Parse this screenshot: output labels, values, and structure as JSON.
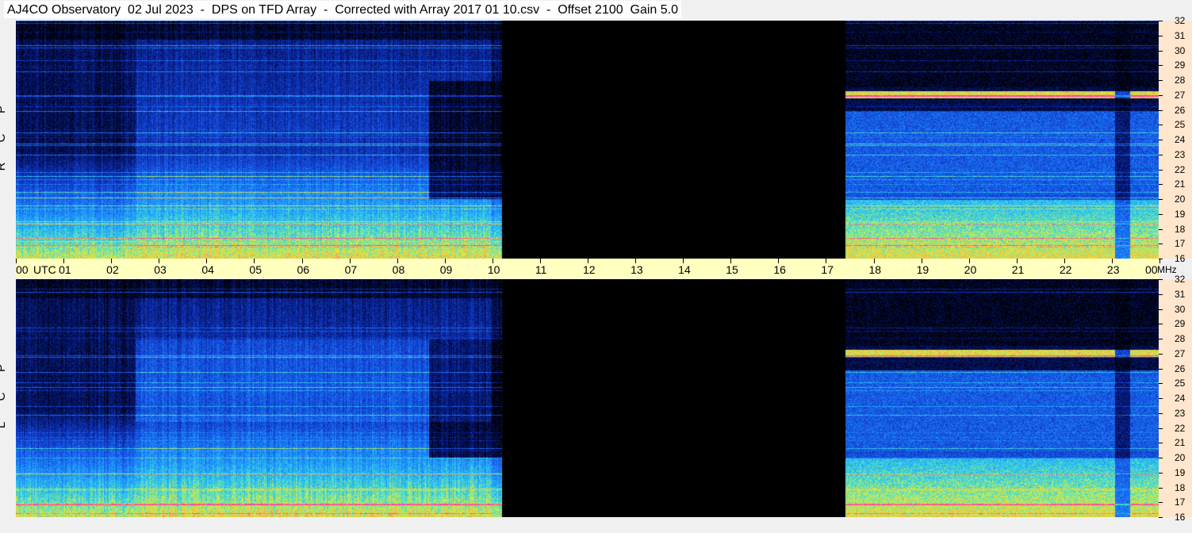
{
  "title": "AJ4CO Observatory  02 Jul 2023  -  DPS on TFD Array  -  Corrected with Array 2017 01 10.csv  -  Offset 2100  Gain 5.0",
  "panels": [
    {
      "polarization": "R C P",
      "letters": [
        "R",
        "C",
        "P"
      ]
    },
    {
      "polarization": "L C P",
      "letters": [
        "L",
        "C",
        "P"
      ]
    }
  ],
  "chart_data": {
    "type": "heatmap",
    "title": "AJ4CO Observatory  02 Jul 2023  -  DPS on TFD Array  -  Corrected with Array 2017 01 10.csv  -  Offset 2100  Gain 5.0",
    "x_axis": {
      "unit_label": "UTC",
      "ticks": [
        "00",
        "01",
        "02",
        "03",
        "04",
        "05",
        "06",
        "07",
        "08",
        "09",
        "10",
        "11",
        "12",
        "13",
        "14",
        "15",
        "16",
        "17",
        "18",
        "19",
        "20",
        "21",
        "22",
        "23",
        "00"
      ],
      "range_hours": [
        0,
        24
      ]
    },
    "y_axis": {
      "unit_label": "MHz",
      "ticks": [
        "16",
        "17",
        "18",
        "19",
        "20",
        "21",
        "22",
        "23",
        "24",
        "25",
        "26",
        "27",
        "28",
        "29",
        "30",
        "31",
        "32"
      ],
      "range": [
        16,
        32
      ]
    },
    "series": [
      {
        "name": "R C P",
        "data_gap_hours": [
          10.2,
          17.4
        ]
      },
      {
        "name": "L C P",
        "data_gap_hours": [
          10.2,
          17.4
        ]
      }
    ],
    "colors": {
      "background": "#000000",
      "low": "#0a2a8a",
      "mid": "#1e7bff",
      "high": "#f0f040",
      "peak": "#ff40a0"
    }
  }
}
